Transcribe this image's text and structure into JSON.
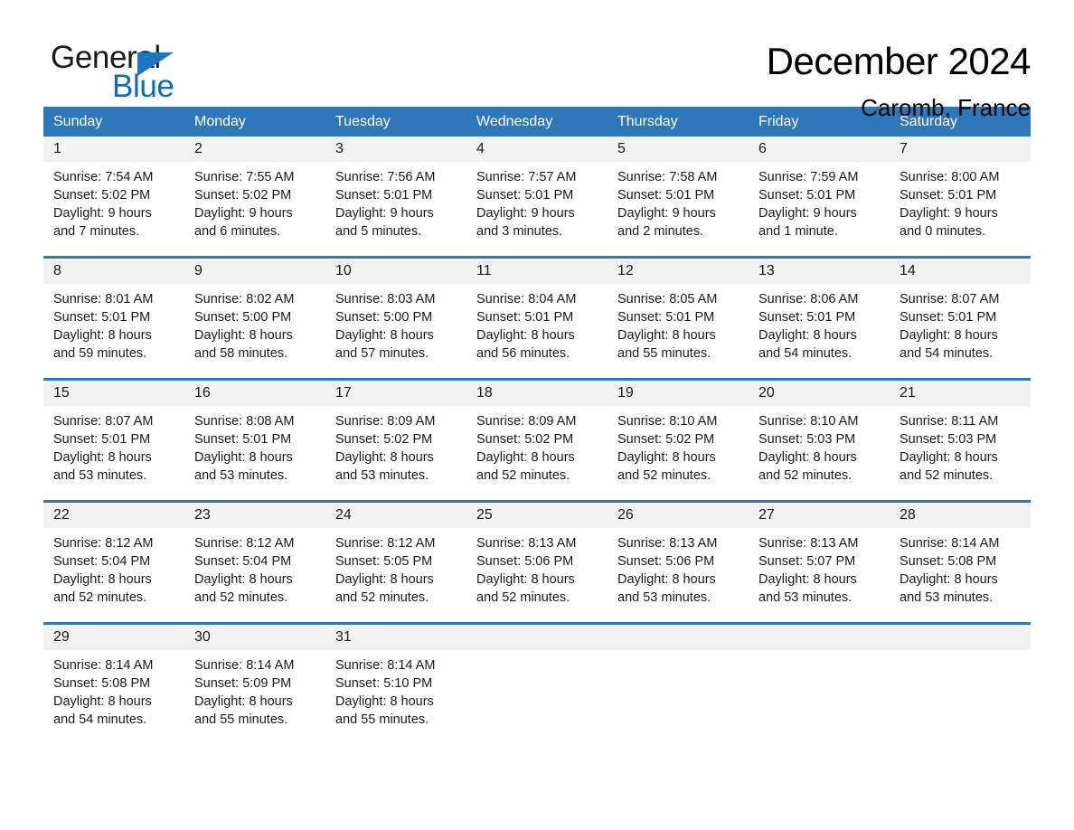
{
  "brand": {
    "word_one": "General",
    "word_two": "Blue",
    "icon": "triangle-logo-icon"
  },
  "header": {
    "month_title": "December 2024",
    "location": "Caromb, France"
  },
  "calendar": {
    "weekdays": [
      "Sunday",
      "Monday",
      "Tuesday",
      "Wednesday",
      "Thursday",
      "Friday",
      "Saturday"
    ],
    "colors": {
      "header_blue": "#2e77b8",
      "daynum_band": "#f1f1f1",
      "brand_blue": "#0d6bb8"
    },
    "weeks": [
      {
        "numbers": [
          "1",
          "2",
          "3",
          "4",
          "5",
          "6",
          "7"
        ],
        "cells": [
          {
            "sunrise": "Sunrise: 7:54 AM",
            "sunset": "Sunset: 5:02 PM",
            "daylight_1": "Daylight: 9 hours",
            "daylight_2": "and 7 minutes."
          },
          {
            "sunrise": "Sunrise: 7:55 AM",
            "sunset": "Sunset: 5:02 PM",
            "daylight_1": "Daylight: 9 hours",
            "daylight_2": "and 6 minutes."
          },
          {
            "sunrise": "Sunrise: 7:56 AM",
            "sunset": "Sunset: 5:01 PM",
            "daylight_1": "Daylight: 9 hours",
            "daylight_2": "and 5 minutes."
          },
          {
            "sunrise": "Sunrise: 7:57 AM",
            "sunset": "Sunset: 5:01 PM",
            "daylight_1": "Daylight: 9 hours",
            "daylight_2": "and 3 minutes."
          },
          {
            "sunrise": "Sunrise: 7:58 AM",
            "sunset": "Sunset: 5:01 PM",
            "daylight_1": "Daylight: 9 hours",
            "daylight_2": "and 2 minutes."
          },
          {
            "sunrise": "Sunrise: 7:59 AM",
            "sunset": "Sunset: 5:01 PM",
            "daylight_1": "Daylight: 9 hours",
            "daylight_2": "and 1 minute."
          },
          {
            "sunrise": "Sunrise: 8:00 AM",
            "sunset": "Sunset: 5:01 PM",
            "daylight_1": "Daylight: 9 hours",
            "daylight_2": "and 0 minutes."
          }
        ]
      },
      {
        "numbers": [
          "8",
          "9",
          "10",
          "11",
          "12",
          "13",
          "14"
        ],
        "cells": [
          {
            "sunrise": "Sunrise: 8:01 AM",
            "sunset": "Sunset: 5:01 PM",
            "daylight_1": "Daylight: 8 hours",
            "daylight_2": "and 59 minutes."
          },
          {
            "sunrise": "Sunrise: 8:02 AM",
            "sunset": "Sunset: 5:00 PM",
            "daylight_1": "Daylight: 8 hours",
            "daylight_2": "and 58 minutes."
          },
          {
            "sunrise": "Sunrise: 8:03 AM",
            "sunset": "Sunset: 5:00 PM",
            "daylight_1": "Daylight: 8 hours",
            "daylight_2": "and 57 minutes."
          },
          {
            "sunrise": "Sunrise: 8:04 AM",
            "sunset": "Sunset: 5:01 PM",
            "daylight_1": "Daylight: 8 hours",
            "daylight_2": "and 56 minutes."
          },
          {
            "sunrise": "Sunrise: 8:05 AM",
            "sunset": "Sunset: 5:01 PM",
            "daylight_1": "Daylight: 8 hours",
            "daylight_2": "and 55 minutes."
          },
          {
            "sunrise": "Sunrise: 8:06 AM",
            "sunset": "Sunset: 5:01 PM",
            "daylight_1": "Daylight: 8 hours",
            "daylight_2": "and 54 minutes."
          },
          {
            "sunrise": "Sunrise: 8:07 AM",
            "sunset": "Sunset: 5:01 PM",
            "daylight_1": "Daylight: 8 hours",
            "daylight_2": "and 54 minutes."
          }
        ]
      },
      {
        "numbers": [
          "15",
          "16",
          "17",
          "18",
          "19",
          "20",
          "21"
        ],
        "cells": [
          {
            "sunrise": "Sunrise: 8:07 AM",
            "sunset": "Sunset: 5:01 PM",
            "daylight_1": "Daylight: 8 hours",
            "daylight_2": "and 53 minutes."
          },
          {
            "sunrise": "Sunrise: 8:08 AM",
            "sunset": "Sunset: 5:01 PM",
            "daylight_1": "Daylight: 8 hours",
            "daylight_2": "and 53 minutes."
          },
          {
            "sunrise": "Sunrise: 8:09 AM",
            "sunset": "Sunset: 5:02 PM",
            "daylight_1": "Daylight: 8 hours",
            "daylight_2": "and 53 minutes."
          },
          {
            "sunrise": "Sunrise: 8:09 AM",
            "sunset": "Sunset: 5:02 PM",
            "daylight_1": "Daylight: 8 hours",
            "daylight_2": "and 52 minutes."
          },
          {
            "sunrise": "Sunrise: 8:10 AM",
            "sunset": "Sunset: 5:02 PM",
            "daylight_1": "Daylight: 8 hours",
            "daylight_2": "and 52 minutes."
          },
          {
            "sunrise": "Sunrise: 8:10 AM",
            "sunset": "Sunset: 5:03 PM",
            "daylight_1": "Daylight: 8 hours",
            "daylight_2": "and 52 minutes."
          },
          {
            "sunrise": "Sunrise: 8:11 AM",
            "sunset": "Sunset: 5:03 PM",
            "daylight_1": "Daylight: 8 hours",
            "daylight_2": "and 52 minutes."
          }
        ]
      },
      {
        "numbers": [
          "22",
          "23",
          "24",
          "25",
          "26",
          "27",
          "28"
        ],
        "cells": [
          {
            "sunrise": "Sunrise: 8:12 AM",
            "sunset": "Sunset: 5:04 PM",
            "daylight_1": "Daylight: 8 hours",
            "daylight_2": "and 52 minutes."
          },
          {
            "sunrise": "Sunrise: 8:12 AM",
            "sunset": "Sunset: 5:04 PM",
            "daylight_1": "Daylight: 8 hours",
            "daylight_2": "and 52 minutes."
          },
          {
            "sunrise": "Sunrise: 8:12 AM",
            "sunset": "Sunset: 5:05 PM",
            "daylight_1": "Daylight: 8 hours",
            "daylight_2": "and 52 minutes."
          },
          {
            "sunrise": "Sunrise: 8:13 AM",
            "sunset": "Sunset: 5:06 PM",
            "daylight_1": "Daylight: 8 hours",
            "daylight_2": "and 52 minutes."
          },
          {
            "sunrise": "Sunrise: 8:13 AM",
            "sunset": "Sunset: 5:06 PM",
            "daylight_1": "Daylight: 8 hours",
            "daylight_2": "and 53 minutes."
          },
          {
            "sunrise": "Sunrise: 8:13 AM",
            "sunset": "Sunset: 5:07 PM",
            "daylight_1": "Daylight: 8 hours",
            "daylight_2": "and 53 minutes."
          },
          {
            "sunrise": "Sunrise: 8:14 AM",
            "sunset": "Sunset: 5:08 PM",
            "daylight_1": "Daylight: 8 hours",
            "daylight_2": "and 53 minutes."
          }
        ]
      },
      {
        "numbers": [
          "29",
          "30",
          "31",
          "",
          "",
          "",
          ""
        ],
        "cells": [
          {
            "sunrise": "Sunrise: 8:14 AM",
            "sunset": "Sunset: 5:08 PM",
            "daylight_1": "Daylight: 8 hours",
            "daylight_2": "and 54 minutes."
          },
          {
            "sunrise": "Sunrise: 8:14 AM",
            "sunset": "Sunset: 5:09 PM",
            "daylight_1": "Daylight: 8 hours",
            "daylight_2": "and 55 minutes."
          },
          {
            "sunrise": "Sunrise: 8:14 AM",
            "sunset": "Sunset: 5:10 PM",
            "daylight_1": "Daylight: 8 hours",
            "daylight_2": "and 55 minutes."
          },
          {
            "sunrise": "",
            "sunset": "",
            "daylight_1": "",
            "daylight_2": ""
          },
          {
            "sunrise": "",
            "sunset": "",
            "daylight_1": "",
            "daylight_2": ""
          },
          {
            "sunrise": "",
            "sunset": "",
            "daylight_1": "",
            "daylight_2": ""
          },
          {
            "sunrise": "",
            "sunset": "",
            "daylight_1": "",
            "daylight_2": ""
          }
        ]
      }
    ]
  }
}
